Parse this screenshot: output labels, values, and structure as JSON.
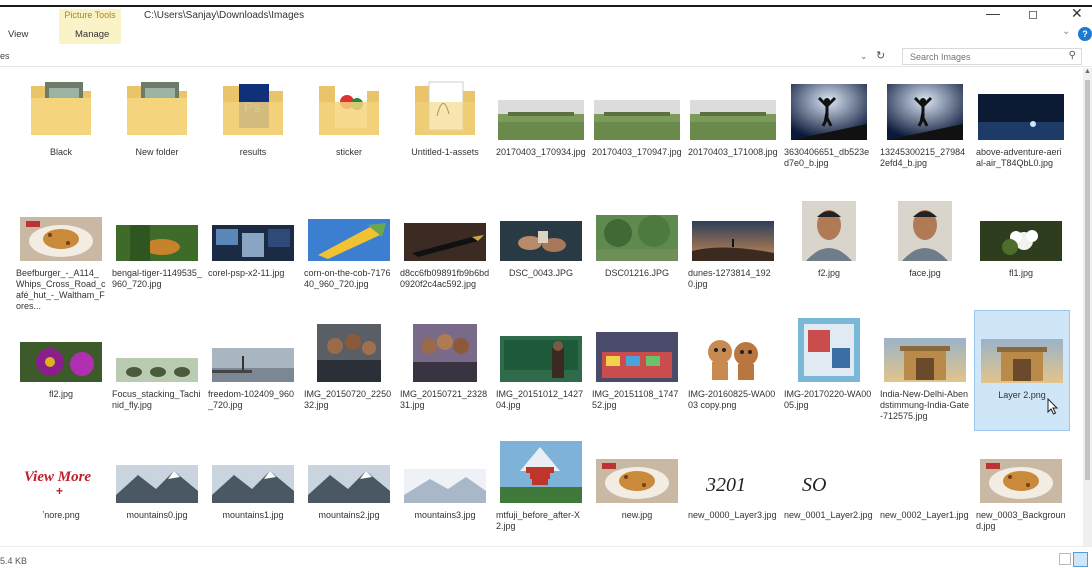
{
  "window": {
    "path_title": "C:\\Users\\Sanjay\\Downloads\\Images",
    "tool_group": "Picture Tools",
    "tabs": [
      "View",
      "Manage"
    ],
    "controls": {
      "minimize": "—",
      "maximize": "◻",
      "close": "✕"
    }
  },
  "address": {
    "text": "es",
    "search_placeholder": "Search Images"
  },
  "items": [
    {
      "name": "Black",
      "kind": "folder",
      "icon": "folder-photo-icon"
    },
    {
      "name": "New folder",
      "kind": "folder",
      "icon": "folder-photo-icon"
    },
    {
      "name": "results",
      "kind": "folder",
      "icon": "folder-photoshop-icon"
    },
    {
      "name": "sticker",
      "kind": "folder",
      "icon": "folder-sticker-icon"
    },
    {
      "name": "Untitled-1-assets",
      "kind": "folder",
      "icon": "folder-document-icon"
    },
    {
      "name": "20170403_170934.jpg",
      "kind": "image",
      "icon": "field-photo"
    },
    {
      "name": "20170403_170947.jpg",
      "kind": "image",
      "icon": "field-photo"
    },
    {
      "name": "20170403_171008.jpg",
      "kind": "image",
      "icon": "field-photo"
    },
    {
      "name": "3630406651_db523ed7e0_b.jpg",
      "kind": "image",
      "icon": "silhouette-photo"
    },
    {
      "name": "13245300215_279842efd4_b.jpg",
      "kind": "image",
      "icon": "silhouette-photo"
    },
    {
      "name": "above-adventure-aerial-air_T84QbL0.jpg",
      "kind": "image",
      "icon": "night-sky-photo"
    },
    {
      "name": "Beefburger_-_A114_Whips_Cross_Road_café_hut_-_Waltham_Fores...",
      "kind": "image",
      "icon": "burger-photo"
    },
    {
      "name": "bengal-tiger-1149535_960_720.jpg",
      "kind": "image",
      "icon": "tiger-photo"
    },
    {
      "name": "corel-psp-x2-11.jpg",
      "kind": "image",
      "icon": "collage-photo"
    },
    {
      "name": "corn-on-the-cob-717640_960_720.jpg",
      "kind": "image",
      "icon": "corn-photo"
    },
    {
      "name": "d8cc6fb09891fb9b6bd0920f2c4ac592.jpg",
      "kind": "image",
      "icon": "pen-photo"
    },
    {
      "name": "DSC_0043.JPG",
      "kind": "image",
      "icon": "hands-photo"
    },
    {
      "name": "DSC01216.JPG",
      "kind": "image",
      "icon": "trees-photo"
    },
    {
      "name": "dunes-1273814_1920.jpg",
      "kind": "image",
      "icon": "dunes-photo"
    },
    {
      "name": "f2.jpg",
      "kind": "image",
      "icon": "portrait-photo"
    },
    {
      "name": "face.jpg",
      "kind": "image",
      "icon": "portrait-photo"
    },
    {
      "name": "fl1.jpg",
      "kind": "image",
      "icon": "flower-photo"
    },
    {
      "name": "fl2.jpg",
      "kind": "image",
      "icon": "dahlia-photo"
    },
    {
      "name": "Focus_stacking_Tachinid_fly.jpg",
      "kind": "image",
      "icon": "fly-photo"
    },
    {
      "name": "freedom-102409_960_720.jpg",
      "kind": "image",
      "icon": "pier-photo"
    },
    {
      "name": "IMG_20150720_225032.jpg",
      "kind": "image",
      "icon": "group-photo"
    },
    {
      "name": "IMG_20150721_232831.jpg",
      "kind": "image",
      "icon": "selfie-photo"
    },
    {
      "name": "IMG_20151012_142704.jpg",
      "kind": "image",
      "icon": "classroom-photo"
    },
    {
      "name": "IMG_20151108_174752.jpg",
      "kind": "image",
      "icon": "market-photo"
    },
    {
      "name": "IMG-20160825-WA0003 copy.png",
      "kind": "image",
      "icon": "puppets-photo"
    },
    {
      "name": "IMG-20170220-WA0005.jpg",
      "kind": "image",
      "icon": "poster-photo"
    },
    {
      "name": "India-New-Delhi-Abendstimmung-India-Gate-712575.jpg",
      "kind": "image",
      "icon": "gate-photo"
    },
    {
      "name": "Layer 2.png",
      "kind": "image",
      "icon": "gate-photo",
      "selected": true
    },
    {
      "name": "...more.png",
      "kind": "image",
      "icon": "view-more-graphic",
      "display": "ʼnore.png",
      "graphic_text": "View More"
    },
    {
      "name": "mountains0.jpg",
      "kind": "image",
      "icon": "mountain-photo"
    },
    {
      "name": "mountains1.jpg",
      "kind": "image",
      "icon": "mountain-photo"
    },
    {
      "name": "mountains2.jpg",
      "kind": "image",
      "icon": "mountain-photo"
    },
    {
      "name": "mountains3.jpg",
      "kind": "image",
      "icon": "mountain-light-photo"
    },
    {
      "name": "mtfuji_before_after-X2.jpg",
      "kind": "image",
      "icon": "pagoda-photo"
    },
    {
      "name": "new.jpg",
      "kind": "image",
      "icon": "burger-photo"
    },
    {
      "name": "new_0000_Layer3.jpg",
      "kind": "image",
      "icon": "handwriting-graphic",
      "graphic_text": "3201"
    },
    {
      "name": "new_0001_Layer2.jpg",
      "kind": "image",
      "icon": "handwriting-graphic",
      "graphic_text": "SO"
    },
    {
      "name": "new_0002_Layer1.jpg",
      "kind": "image",
      "icon": "blank-graphic"
    },
    {
      "name": "new_0003_Background.jpg",
      "kind": "image",
      "icon": "burger-photo"
    }
  ],
  "status": {
    "text": "5.4 KB"
  }
}
